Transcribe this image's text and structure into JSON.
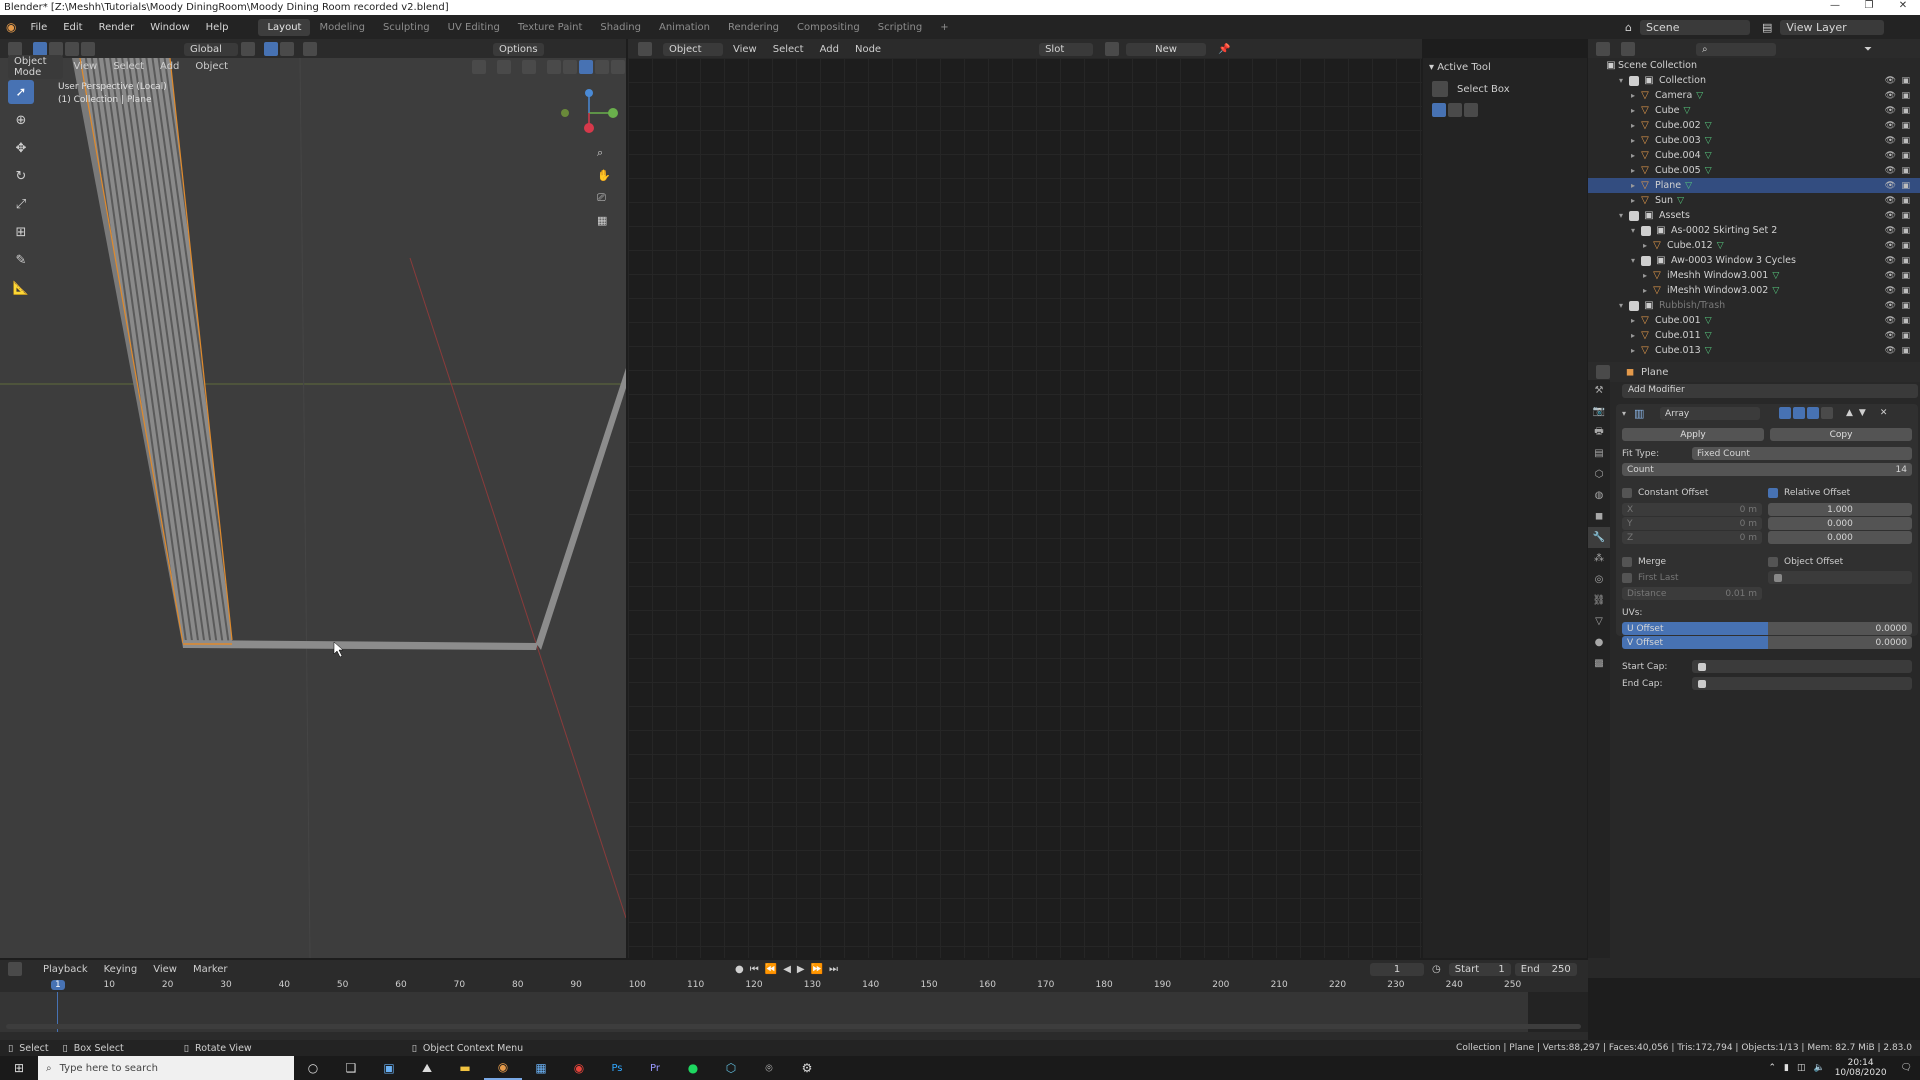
{
  "window": {
    "title": "Blender* [Z:\\Meshh\\Tutorials\\Moody DiningRoom\\Moody Dining Room recorded v2.blend]"
  },
  "menus": [
    "File",
    "Edit",
    "Render",
    "Window",
    "Help"
  ],
  "workspaces": [
    "Layout",
    "Modeling",
    "Sculpting",
    "UV Editing",
    "Texture Paint",
    "Shading",
    "Animation",
    "Rendering",
    "Compositing",
    "Scripting"
  ],
  "scene": {
    "label": "Scene",
    "view_layer": "View Layer"
  },
  "viewport": {
    "mode": "Object Mode",
    "menu": [
      "View",
      "Select",
      "Add",
      "Object"
    ],
    "transform": "Global",
    "options": "Options",
    "overlay_line1": "User Perspective (Local)",
    "overlay_line2": "(1) Collection | Plane"
  },
  "node_editor": {
    "type": "Object",
    "menu": [
      "View",
      "Select",
      "Add",
      "Node"
    ],
    "slot": "Slot",
    "new": "New"
  },
  "active_tool": {
    "header": "Active Tool",
    "tool": "Select Box"
  },
  "outliner": {
    "root": "Scene Collection",
    "rows": [
      {
        "name": "Collection",
        "level": 1,
        "kind": "collection"
      },
      {
        "name": "Camera",
        "level": 2,
        "kind": "object"
      },
      {
        "name": "Cube",
        "level": 2,
        "kind": "object"
      },
      {
        "name": "Cube.002",
        "level": 2,
        "kind": "object"
      },
      {
        "name": "Cube.003",
        "level": 2,
        "kind": "object"
      },
      {
        "name": "Cube.004",
        "level": 2,
        "kind": "object"
      },
      {
        "name": "Cube.005",
        "level": 2,
        "kind": "object"
      },
      {
        "name": "Plane",
        "level": 2,
        "kind": "object",
        "selected": true
      },
      {
        "name": "Sun",
        "level": 2,
        "kind": "object"
      },
      {
        "name": "Assets",
        "level": 1,
        "kind": "collection"
      },
      {
        "name": "As-0002 Skirting Set 2",
        "level": 2,
        "kind": "collection"
      },
      {
        "name": "Cube.012",
        "level": 3,
        "kind": "object"
      },
      {
        "name": "Aw-0003 Window 3 Cycles",
        "level": 2,
        "kind": "collection"
      },
      {
        "name": "iMeshh Window3.001",
        "level": 3,
        "kind": "object"
      },
      {
        "name": "iMeshh Window3.002",
        "level": 3,
        "kind": "object"
      },
      {
        "name": "Rubbish/Trash",
        "level": 1,
        "kind": "collection"
      },
      {
        "name": "Cube.001",
        "level": 2,
        "kind": "object"
      },
      {
        "name": "Cube.011",
        "level": 2,
        "kind": "object"
      },
      {
        "name": "Cube.013",
        "level": 2,
        "kind": "object"
      }
    ]
  },
  "properties": {
    "object": "Plane",
    "add_modifier": "Add Modifier",
    "modifier_name": "Array",
    "apply": "Apply",
    "copy": "Copy",
    "fit_type_label": "Fit Type:",
    "fit_type": "Fixed Count",
    "count_label": "Count",
    "count": "14",
    "constant_offset": "Constant Offset",
    "relative_offset": "Relative Offset",
    "const_x": "0 m",
    "const_y": "0 m",
    "const_z": "0 m",
    "x_label": "X",
    "y_label": "Y",
    "z_label": "Z",
    "rel_x": "1.000",
    "rel_y": "0.000",
    "rel_z": "0.000",
    "merge": "Merge",
    "object_offset": "Object Offset",
    "first_last": "First Last",
    "distance_label": "Distance",
    "distance": "0.01 m",
    "uvs": "UVs:",
    "u_offset": "U Offset",
    "u_val": "0.0000",
    "v_offset": "V Offset",
    "v_val": "0.0000",
    "start_cap": "Start Cap:",
    "end_cap": "End Cap:"
  },
  "timeline": {
    "menu": [
      "Playback",
      "Keying",
      "View",
      "Marker"
    ],
    "current": "1",
    "start_label": "Start",
    "start": "1",
    "end_label": "End",
    "end": "250",
    "ticks": [
      "1",
      "10",
      "20",
      "30",
      "40",
      "50",
      "60",
      "70",
      "80",
      "90",
      "100",
      "110",
      "120",
      "130",
      "140",
      "150",
      "160",
      "170",
      "180",
      "190",
      "200",
      "210",
      "220",
      "230",
      "240",
      "250"
    ]
  },
  "status": {
    "select": "Select",
    "box_select": "Box Select",
    "rotate": "Rotate View",
    "context": "Object Context Menu",
    "stats": "Collection | Plane | Verts:88,297 | Faces:40,056 | Tris:172,794 | Objects:1/13 | Mem: 82.7 MiB | 2.83.0"
  },
  "taskbar": {
    "search": "Type here to search",
    "time": "20:14",
    "date": "10/08/2020"
  }
}
